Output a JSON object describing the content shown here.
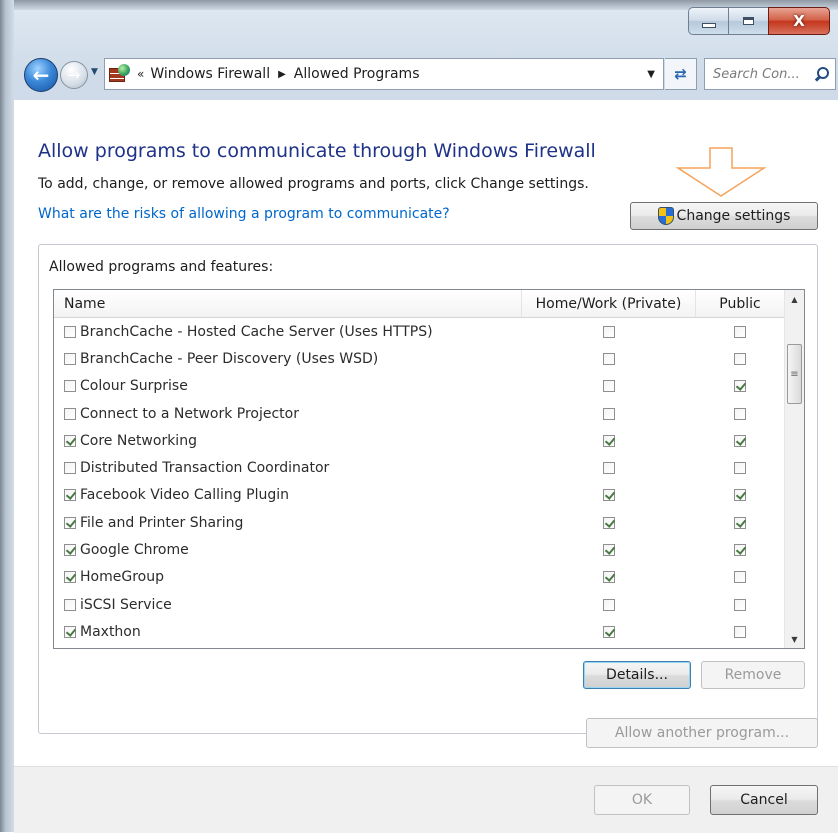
{
  "window": {
    "caption": {
      "minimize_icon": "minimize-icon",
      "maximize_icon": "maximize-icon",
      "close_label": "X"
    }
  },
  "nav": {
    "breadcrumb_prefix": "«",
    "breadcrumbs": [
      "Windows Firewall",
      "Allowed Programs"
    ],
    "search_placeholder": "Search Con..."
  },
  "main": {
    "title": "Allow programs to communicate through Windows Firewall",
    "subtitle": "To add, change, or remove allowed programs and ports, click Change settings.",
    "risk_link": "What are the risks of allowing a program to communicate?",
    "change_settings_label": "Change settings"
  },
  "list": {
    "group_label": "Allowed programs and features:",
    "columns": {
      "name": "Name",
      "home": "Home/Work (Private)",
      "public": "Public"
    },
    "rows": [
      {
        "name": "BranchCache - Hosted Cache Server (Uses HTTPS)",
        "enabled": false,
        "home": false,
        "public": false
      },
      {
        "name": "BranchCache - Peer Discovery (Uses WSD)",
        "enabled": false,
        "home": false,
        "public": false
      },
      {
        "name": "Colour Surprise",
        "enabled": false,
        "home": false,
        "public": true
      },
      {
        "name": "Connect to a Network Projector",
        "enabled": false,
        "home": false,
        "public": false
      },
      {
        "name": "Core Networking",
        "enabled": true,
        "home": true,
        "public": true
      },
      {
        "name": "Distributed Transaction Coordinator",
        "enabled": false,
        "home": false,
        "public": false
      },
      {
        "name": "Facebook Video Calling Plugin",
        "enabled": true,
        "home": true,
        "public": true
      },
      {
        "name": "File and Printer Sharing",
        "enabled": true,
        "home": true,
        "public": true
      },
      {
        "name": "Google Chrome",
        "enabled": true,
        "home": true,
        "public": true
      },
      {
        "name": "HomeGroup",
        "enabled": true,
        "home": true,
        "public": false
      },
      {
        "name": "iSCSI Service",
        "enabled": false,
        "home": false,
        "public": false
      },
      {
        "name": "Maxthon",
        "enabled": true,
        "home": true,
        "public": false
      }
    ],
    "details_label": "Details...",
    "remove_label": "Remove"
  },
  "actions": {
    "allow_another_label": "Allow another program...",
    "ok_label": "OK",
    "cancel_label": "Cancel"
  },
  "colors": {
    "title": "#1e3287",
    "link": "#0066cc",
    "annotation_arrow": "#f5a25a",
    "close_button": "#c4361d"
  }
}
